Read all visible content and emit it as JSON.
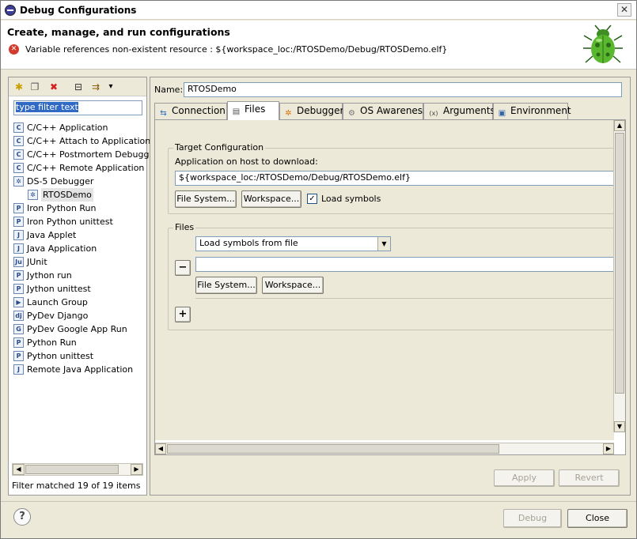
{
  "window": {
    "title": "Debug Configurations",
    "close_glyph": "✕"
  },
  "header": {
    "heading": "Create, manage, and run configurations",
    "error_message": "Variable references non-existent resource : ${workspace_loc:/RTOSDemo/Debug/RTOSDemo.elf}",
    "error_glyph": "✕"
  },
  "left": {
    "toolbar": [
      {
        "name": "new-config-icon",
        "glyph": "✱"
      },
      {
        "name": "duplicate-icon",
        "glyph": "❐"
      },
      {
        "name": "delete-icon",
        "glyph": "✖"
      },
      {
        "name": "collapse-all-icon",
        "glyph": "⊟"
      },
      {
        "name": "filter-icon",
        "glyph": "⇉"
      },
      {
        "name": "menu-dropdown-icon",
        "glyph": "▾"
      }
    ],
    "filter_text": "type filter text",
    "tree": [
      {
        "label": "C/C++ Application",
        "glyph": "C"
      },
      {
        "label": "C/C++ Attach to Application",
        "glyph": "C"
      },
      {
        "label": "C/C++ Postmortem Debugger",
        "glyph": "C"
      },
      {
        "label": "C/C++ Remote Application",
        "glyph": "C"
      },
      {
        "label": "DS-5 Debugger",
        "glyph": "✲"
      },
      {
        "label": "RTOSDemo",
        "glyph": "✲",
        "child": true,
        "selected": true
      },
      {
        "label": "Iron Python Run",
        "glyph": "P"
      },
      {
        "label": "Iron Python unittest",
        "glyph": "P"
      },
      {
        "label": "Java Applet",
        "glyph": "J"
      },
      {
        "label": "Java Application",
        "glyph": "J"
      },
      {
        "label": "JUnit",
        "glyph": "Ju"
      },
      {
        "label": "Jython run",
        "glyph": "P"
      },
      {
        "label": "Jython unittest",
        "glyph": "P"
      },
      {
        "label": "Launch Group",
        "glyph": "▶"
      },
      {
        "label": "PyDev Django",
        "glyph": "dj"
      },
      {
        "label": "PyDev Google App Run",
        "glyph": "G"
      },
      {
        "label": "Python Run",
        "glyph": "P"
      },
      {
        "label": "Python unittest",
        "glyph": "P"
      },
      {
        "label": "Remote Java Application",
        "glyph": "J"
      }
    ],
    "status": "Filter matched 19 of 19 items"
  },
  "right": {
    "name_label": "Name:",
    "name_value": "RTOSDemo",
    "tabs": [
      {
        "label": "Connection",
        "glyph": "⇆"
      },
      {
        "label": "Files",
        "glyph": "▤",
        "active": true
      },
      {
        "label": "Debugger",
        "glyph": "✲"
      },
      {
        "label": "OS Awareness",
        "glyph": "⚙"
      },
      {
        "label": "Arguments",
        "glyph": "(x)"
      },
      {
        "label": "Environment",
        "glyph": "▣"
      }
    ],
    "target": {
      "title": "Target Configuration",
      "app_label": "Application on host to download:",
      "app_path": "${workspace_loc:/RTOSDemo/Debug/RTOSDemo.elf}",
      "file_system_btn": "File System...",
      "workspace_btn": "Workspace...",
      "load_symbols_label": "Load symbols",
      "load_symbols_checked": "✓"
    },
    "files": {
      "title": "Files",
      "dropdown_value": "Load symbols from file",
      "path_value": "",
      "remove_btn": "−",
      "add_btn": "+",
      "file_system_btn": "File System...",
      "workspace_btn": "Workspace..."
    },
    "apply_btn": "Apply",
    "revert_btn": "Revert"
  },
  "footer": {
    "help_glyph": "?",
    "debug_btn": "Debug",
    "close_btn": "Close"
  }
}
